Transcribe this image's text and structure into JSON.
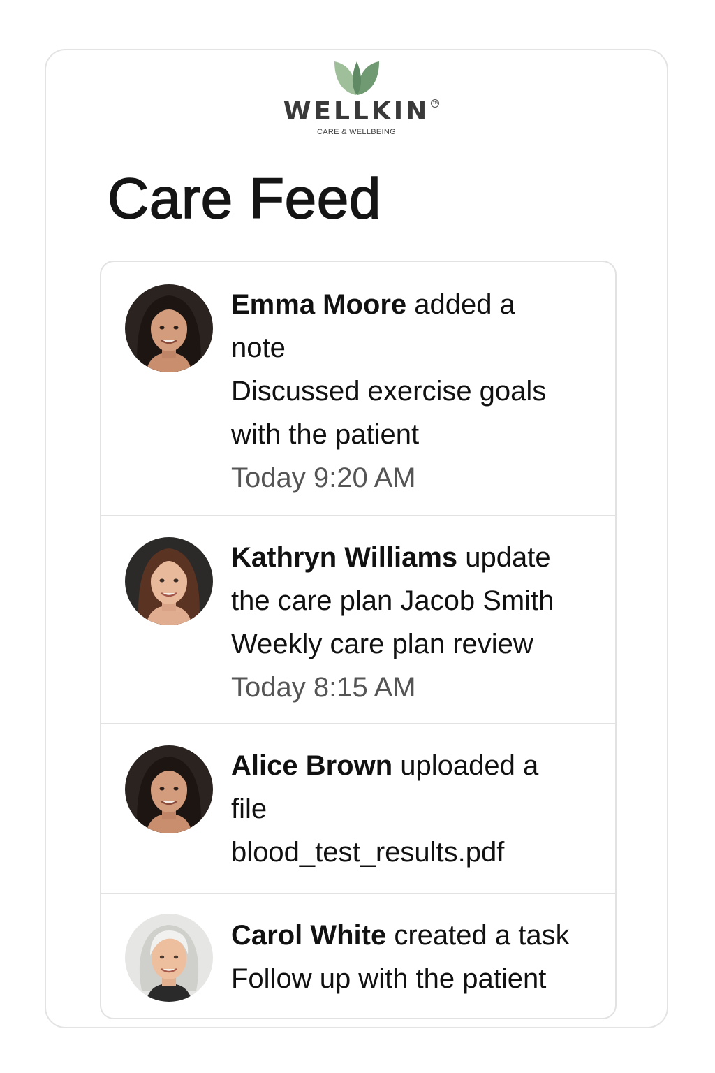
{
  "brand": {
    "name": "WELLKIN",
    "tagline": "CARE & WELLBEING",
    "trademark": "TM",
    "leaf_color_dark": "#6f9a72",
    "leaf_color_light": "#9ebf9a"
  },
  "page": {
    "title": "Care Feed"
  },
  "feed": [
    {
      "actor": "Emma Moore",
      "action_line1": "added a",
      "action_line2": "note",
      "detail_line1": "Discussed exercise goals",
      "detail_line2": "with the patient",
      "time": "Today 9:20 AM",
      "avatar_icon": "woman-dark-hair-avatar"
    },
    {
      "actor": "Kathryn Williams",
      "action_line1": "update",
      "action_line2": "the care plan Jacob Smith",
      "detail_line1": "Weekly care plan review",
      "time": "Today 8:15 AM",
      "avatar_icon": "woman-brown-hair-avatar"
    },
    {
      "actor": "Alice Brown",
      "action_line1": "uploaded a",
      "action_line2": "file",
      "detail_line1": "blood_test_results.pdf",
      "avatar_icon": "woman-dark-hair-avatar"
    },
    {
      "actor": "Carol White",
      "action_line1": "created a task",
      "detail_line1": "Follow up with the patient",
      "avatar_icon": "woman-gray-hair-avatar"
    }
  ]
}
